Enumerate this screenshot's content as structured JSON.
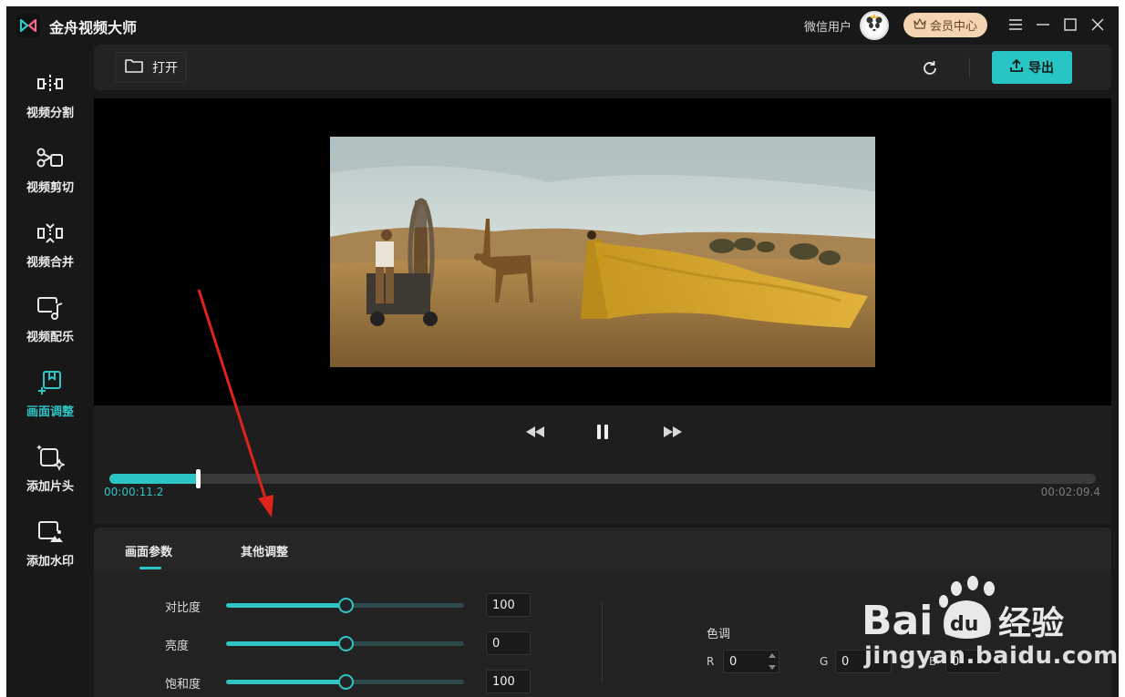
{
  "app": {
    "title": "金舟视频大师",
    "user_name": "微信用户",
    "vip_label": "会员中心"
  },
  "sidebar": {
    "items": [
      {
        "label": "视频分割",
        "icon": "split-icon"
      },
      {
        "label": "视频剪切",
        "icon": "scissors-icon"
      },
      {
        "label": "视频合并",
        "icon": "merge-icon"
      },
      {
        "label": "视频配乐",
        "icon": "music-icon"
      },
      {
        "label": "画面调整",
        "icon": "adjust-icon",
        "active": true
      },
      {
        "label": "添加片头",
        "icon": "intro-icon"
      },
      {
        "label": "添加水印",
        "icon": "watermark-icon"
      }
    ]
  },
  "toolbar": {
    "open_label": "打开",
    "export_label": "导出"
  },
  "player": {
    "current_time": "00:00:11.2",
    "total_time": "00:02:09.4",
    "progress_fraction": 0.09
  },
  "panel": {
    "tabs": [
      "画面参数",
      "其他调整"
    ],
    "active_tab": "画面参数",
    "params": [
      {
        "label": "对比度",
        "value": "100",
        "fraction": 0.5
      },
      {
        "label": "亮度",
        "value": "0",
        "fraction": 0.5
      },
      {
        "label": "饱和度",
        "value": "100",
        "fraction": 0.5
      }
    ],
    "hue": {
      "label": "色调",
      "r_label": "R",
      "r_value": "0",
      "g_label": "G",
      "g_value": "0",
      "b_label": "B",
      "b_value": "0"
    }
  },
  "watermark": {
    "brand": "Bai du 经验",
    "url": "jingyan.baidu.com"
  },
  "colors": {
    "accent": "#2ec5c5",
    "background": "#181818",
    "vip": "#f3d5b1",
    "annotation_arrow": "#e0241c"
  }
}
